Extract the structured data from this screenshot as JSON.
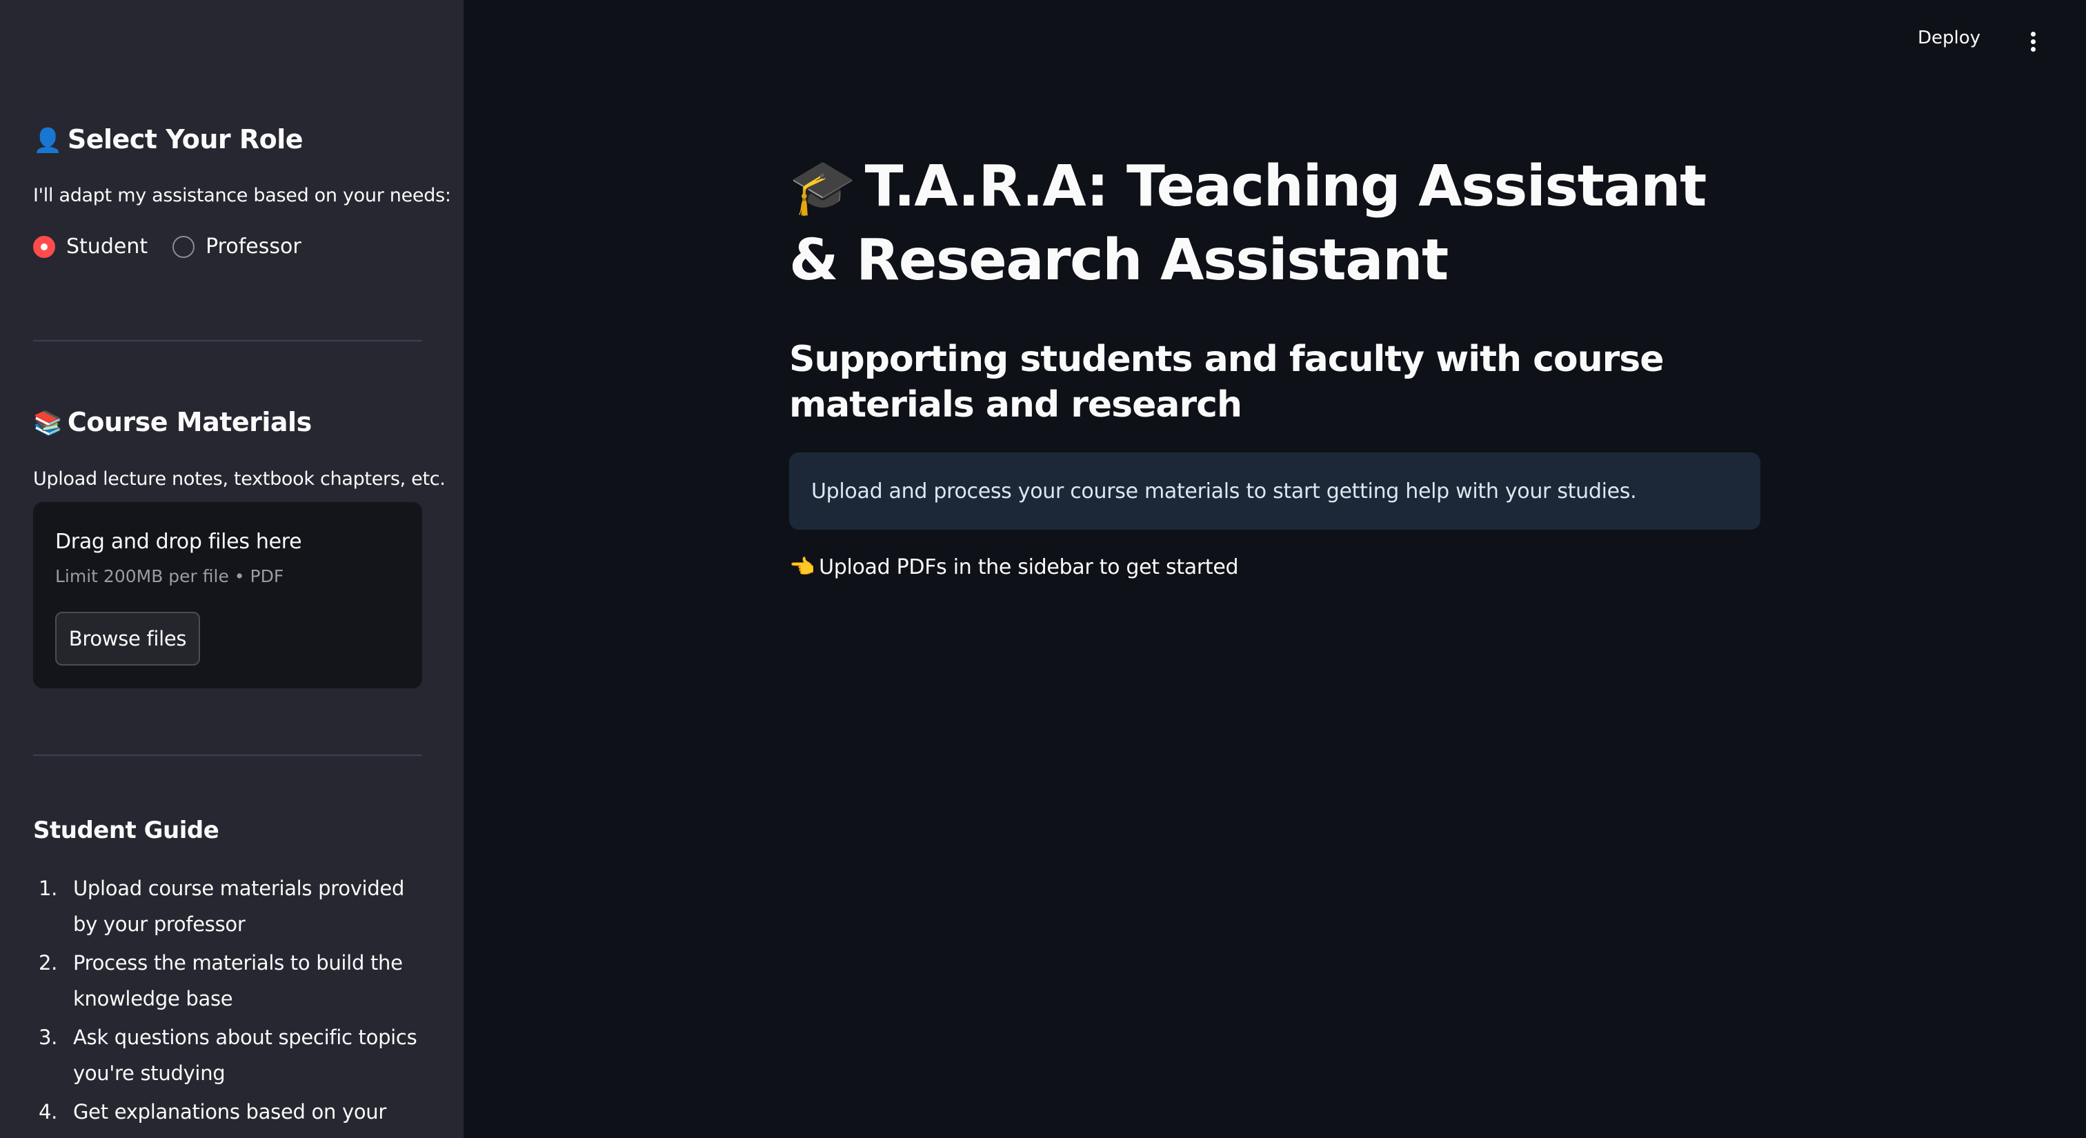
{
  "header": {
    "deploy_label": "Deploy",
    "menu_icon": "vertical-ellipsis-icon"
  },
  "sidebar": {
    "role_section": {
      "emoji": "👤",
      "title": "Select Your Role",
      "description": "I'll adapt my assistance based on your needs:",
      "options": [
        {
          "label": "Student",
          "selected": true
        },
        {
          "label": "Professor",
          "selected": false
        }
      ]
    },
    "materials_section": {
      "emoji": "📚",
      "title": "Course Materials",
      "description": "Upload lecture notes, textbook chapters, etc.",
      "dropzone_title": "Drag and drop files here",
      "dropzone_limit": "Limit 200MB per file • PDF",
      "browse_label": "Browse files"
    },
    "guide": {
      "title": "Student Guide",
      "items": [
        {
          "num": "1.",
          "text": "Upload course materials provided by your professor"
        },
        {
          "num": "2.",
          "text": "Process the materials to build the knowledge base"
        },
        {
          "num": "3.",
          "text": "Ask questions about specific topics you're studying"
        },
        {
          "num": "4.",
          "text": "Get explanations based on your"
        }
      ]
    }
  },
  "main": {
    "title_emoji": "🎓",
    "title": "T.A.R.A: Teaching Assistant & Research Assistant",
    "subtitle": "Supporting students and faculty with course materials and research",
    "info": "Upload and process your course materials to start getting help with your studies.",
    "hint_emoji": "👈",
    "hint": "Upload PDFs in the sidebar to get started"
  },
  "colors": {
    "background": "#0e1117",
    "sidebar": "#262730",
    "accent": "#ff4b4b",
    "info_box": "#1c2838"
  }
}
